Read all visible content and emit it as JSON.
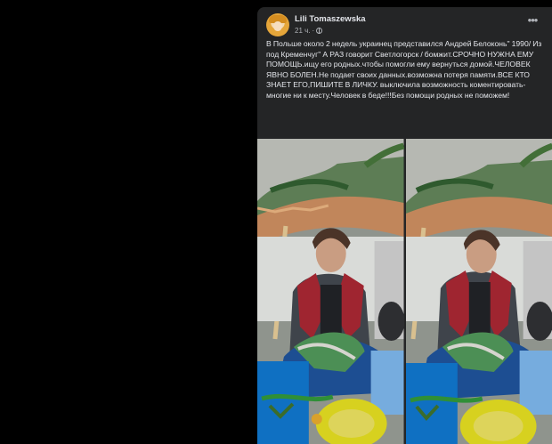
{
  "post": {
    "author": "Lili Tomaszewska",
    "time": "21 ч.",
    "separator": "·",
    "text": "В Польше около 2 недель украинец представился Андрей Белоконь\" 1990/ Из под Кременчуг\" А РАЗ говорит Светлогорск / бомжит.СРОЧНО НУЖНА ЕМУ ПОМОЩЬ.ищу его родных.чтобы помогли ему вернуться домой.ЧЕЛОВЕК ЯВНО БОЛЕН.Не подает своих данных.возможна потеря памяти.ВСЕ КТО ЗНАЕТ ЕГО,ПИШИТЕ В ЛИЧКУ. выключила возможность коментировать-многие ни к месту.Человек в беде!!!Без помощи родных не поможем!",
    "more_icon": "more-horizontal-icon",
    "privacy_icon": "globe-icon"
  },
  "photos": [
    {
      "name": "photo-left",
      "description_icon": "photo"
    },
    {
      "name": "photo-right",
      "description_icon": "photo"
    }
  ],
  "colors": {
    "page_bg": "#000000",
    "card_bg": "#242526",
    "primary_text": "#e4e6eb",
    "secondary_text": "#b0b3b8"
  }
}
